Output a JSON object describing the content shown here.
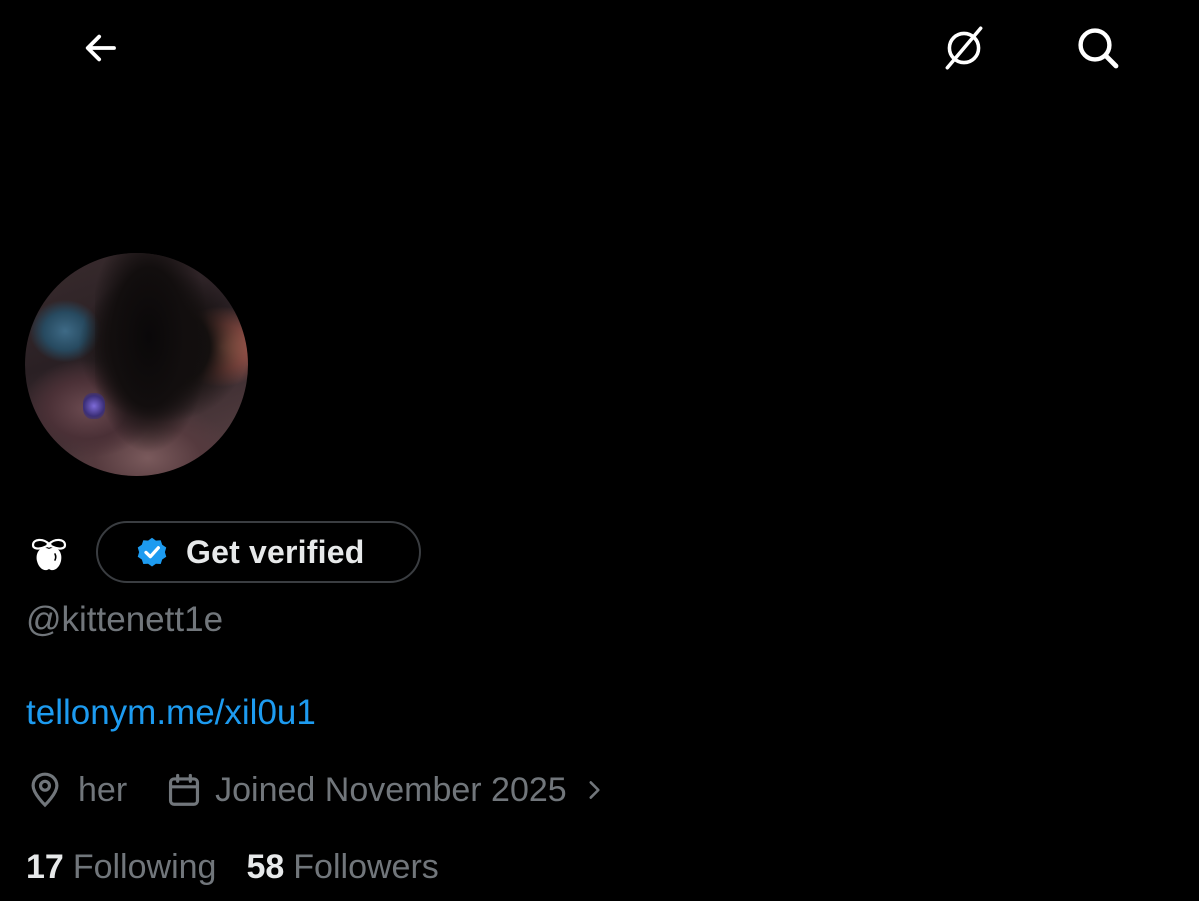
{
  "nav": {
    "back_icon": "arrow-left-icon",
    "grok_icon": "grok-icon",
    "search_icon": "search-icon"
  },
  "profile": {
    "avatar": "profile-photo",
    "name_emoji": "apple-bow-emoji",
    "verify_button_label": "Get verified",
    "verify_badge_color": "#1d9bf0",
    "handle": "@kittenett1e",
    "link": "tellonym.me/xil0u1",
    "location": "her",
    "location_icon": "location-pin-icon",
    "joined": "Joined November 2025",
    "joined_icon": "calendar-icon",
    "joined_chevron_icon": "chevron-right-icon",
    "following_count": "17",
    "following_label": "Following",
    "followers_count": "58",
    "followers_label": "Followers"
  },
  "colors": {
    "background": "#000000",
    "primary_text": "#e7e9ea",
    "secondary_text": "#71767b",
    "link": "#1d9bf0",
    "button_border": "#3a3d41"
  }
}
